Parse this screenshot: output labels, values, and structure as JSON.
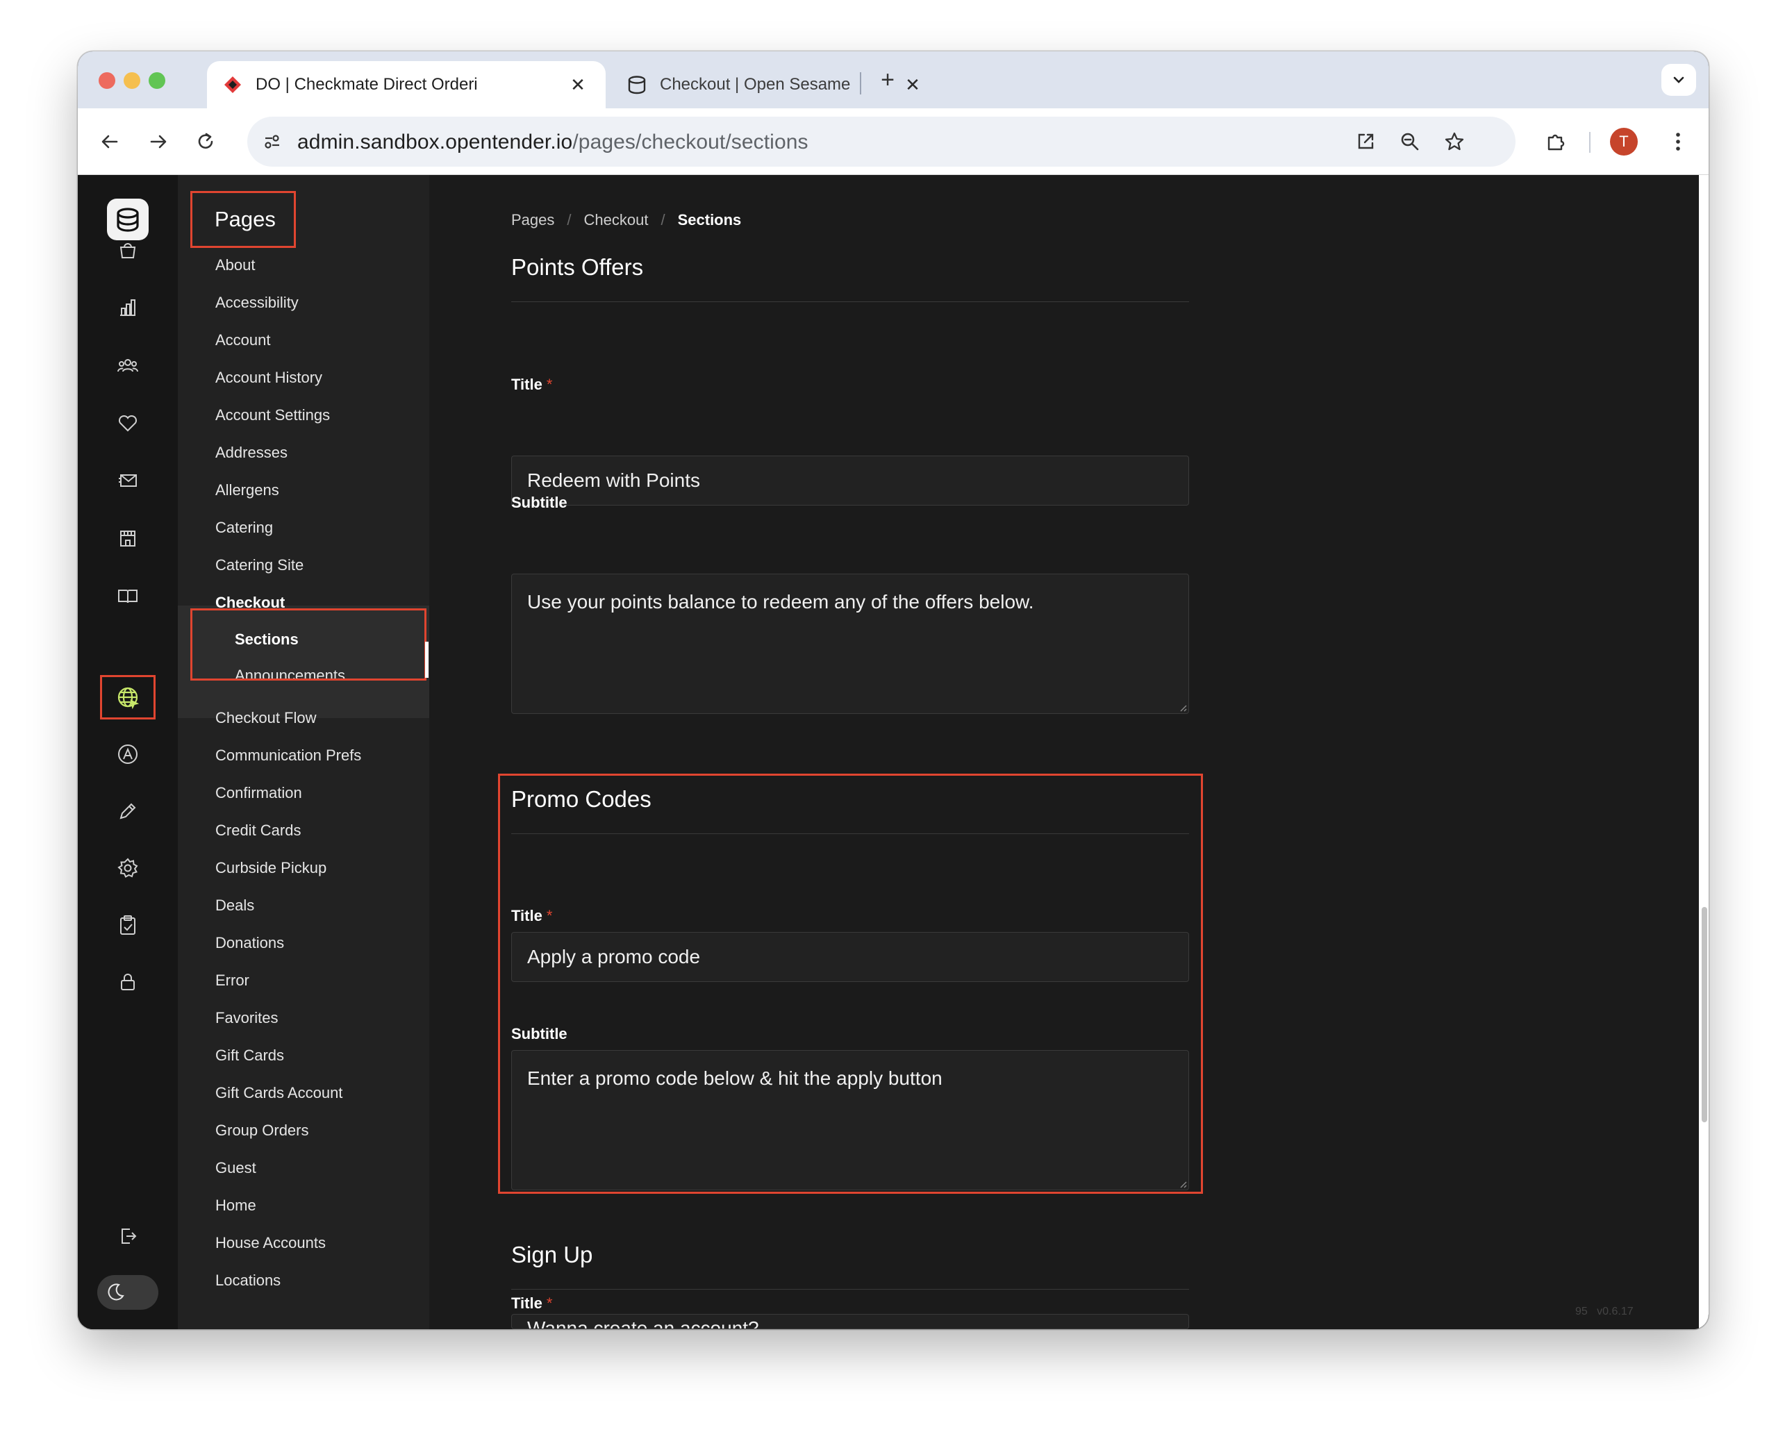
{
  "browser": {
    "tabs": [
      {
        "title": "DO | Checkmate Direct Orderi",
        "close": "✕"
      },
      {
        "title": "Checkout | Open Sesame",
        "close": "✕"
      }
    ],
    "new_tab": "+",
    "url_host": "admin.sandbox.opentender.io",
    "url_path": "/pages/checkout/sections",
    "profile_initial": "T"
  },
  "sidebar": {
    "title": "Pages",
    "items": [
      "About",
      "Accessibility",
      "Account",
      "Account History",
      "Account Settings",
      "Addresses",
      "Allergens",
      "Catering",
      "Catering Site"
    ],
    "active_group": "Checkout",
    "active_sub": "Sections",
    "sub_items": [
      "Announcements"
    ],
    "items_after": [
      "Checkout Flow",
      "Communication Prefs",
      "Confirmation",
      "Credit Cards",
      "Curbside Pickup",
      "Deals",
      "Donations",
      "Error",
      "Favorites",
      "Gift Cards",
      "Gift Cards Account",
      "Group Orders",
      "Guest",
      "Home",
      "House Accounts",
      "Locations"
    ]
  },
  "rail": {
    "icons": [
      "bag-icon",
      "chart-icon",
      "customers-icon",
      "heart-icon",
      "mail-icon",
      "store-icon",
      "book-icon",
      "globe-icon",
      "badge-icon",
      "pencil-icon",
      "gear-icon",
      "clipboard-icon",
      "lock-icon"
    ],
    "active": "globe-icon"
  },
  "breadcrumb": {
    "items": [
      "Pages",
      "Checkout"
    ],
    "current": "Sections",
    "separator": "/"
  },
  "sections": [
    {
      "name": "Points Offers",
      "title_label": "Title",
      "title_value": "Redeem with Points",
      "subtitle_label": "Subtitle",
      "subtitle_value": "Use your points balance to redeem any of the offers below."
    },
    {
      "name": "Promo Codes",
      "title_label": "Title",
      "title_value": "Apply a promo code",
      "subtitle_label": "Subtitle",
      "subtitle_value": "Enter a promo code below & hit the apply button"
    },
    {
      "name": "Sign Up",
      "title_label": "Title",
      "title_value": "Wanna create an account?"
    }
  ],
  "required_mark": "*",
  "footer": {
    "count": "95",
    "version": "v0.6.17"
  },
  "colors": {
    "highlight": "#e04530",
    "accent_icon": "#c8e86a"
  }
}
